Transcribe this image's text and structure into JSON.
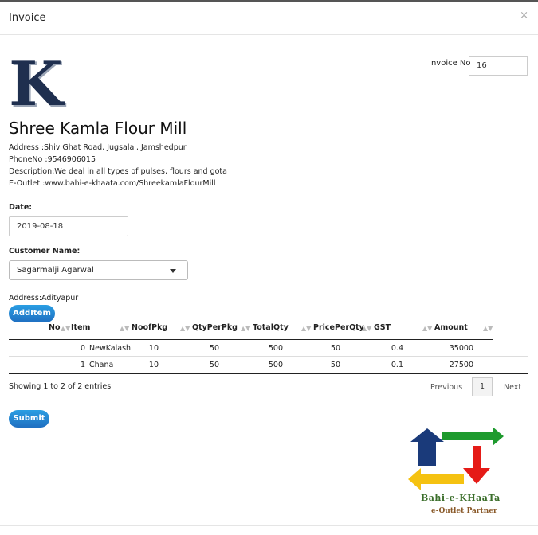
{
  "modal": {
    "title": "Invoice",
    "close_glyph": "×"
  },
  "shop": {
    "logo_letter": "K",
    "name": "Shree Kamla Flour Mill",
    "address": "Address :Shiv Ghat Road, Jugsalai, Jamshedpur",
    "phone": "PhoneNo :9546906015",
    "description": "Description:We deal in all types of pulses, flours and gota",
    "eoutlet": "E-Outlet :www.bahi-e-khaata.com/ShreekamlaFlourMill"
  },
  "invoice": {
    "label": "Invoice No",
    "value": "16"
  },
  "date": {
    "label": "Date:",
    "value": "2019-08-18"
  },
  "customer": {
    "label": "Customer Name:",
    "value": "Sagarmalji Agarwal",
    "address": "Address:Adityapur"
  },
  "buttons": {
    "add_item": "AddItem",
    "submit": "Submit"
  },
  "table": {
    "headers": [
      "No",
      "Item",
      "NoofPkg",
      "QtyPerPkg",
      "TotalQty",
      "PricePerQty",
      "GST",
      "Amount"
    ],
    "rows": [
      [
        "0",
        "NewKalash",
        "10",
        "50",
        "500",
        "50",
        "0.4",
        "35000"
      ],
      [
        "1",
        "Chana",
        "10",
        "50",
        "500",
        "50",
        "0.1",
        "27500"
      ]
    ]
  },
  "pagination": {
    "info": "Showing 1 to 2 of 2 entries",
    "previous": "Previous",
    "current": "1",
    "next": "Next"
  },
  "brand": {
    "name": "Bahi-e-KHaaTa",
    "tagline": "e-Outlet Partner"
  }
}
